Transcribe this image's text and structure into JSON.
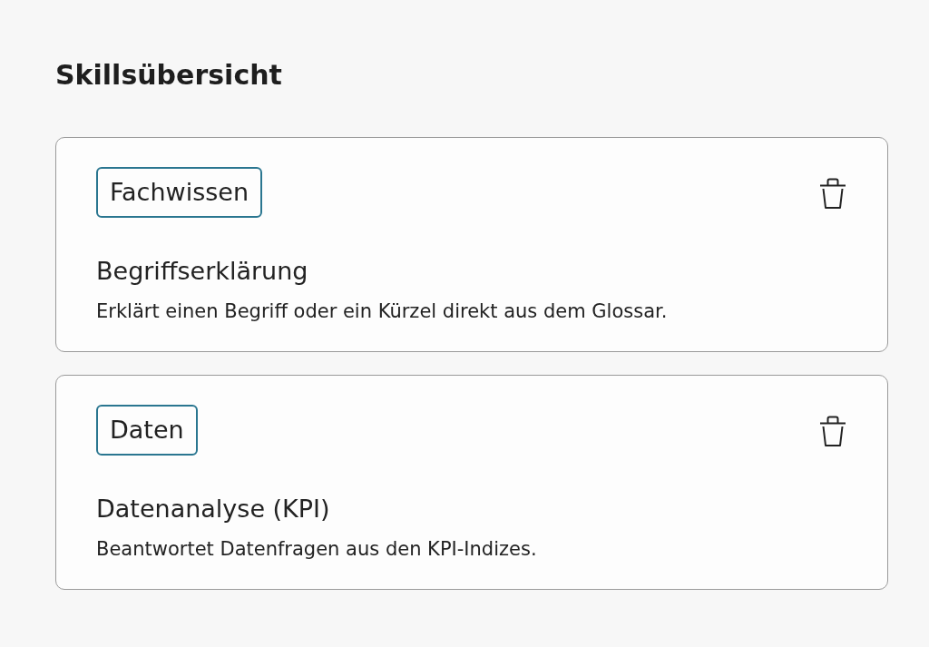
{
  "page": {
    "title": "Skillsübersicht"
  },
  "skills": [
    {
      "category": "Fachwissen",
      "name": "Begriffserklärung",
      "description": "Erklärt einen Begriff oder ein Kürzel direkt aus dem Glossar."
    },
    {
      "category": "Daten",
      "name": "Datenanalyse (KPI)",
      "description": "Beantwortet Datenfragen aus den KPI-Indizes."
    }
  ]
}
